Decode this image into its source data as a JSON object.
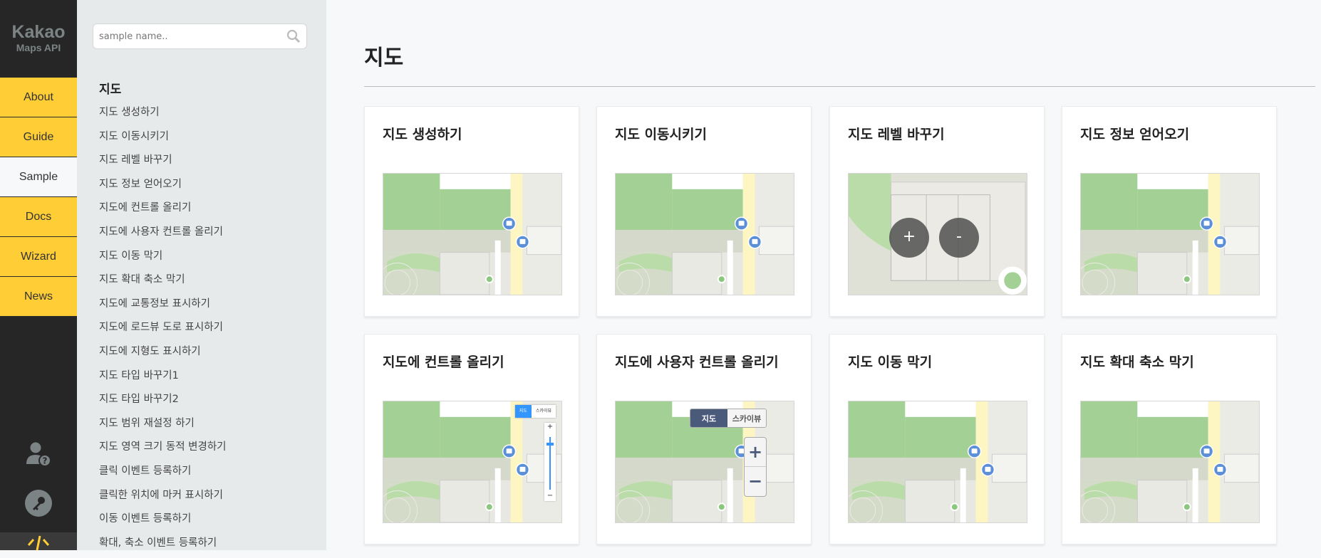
{
  "logo": {
    "line1": "Kakao",
    "line2": "Maps API"
  },
  "nav": [
    {
      "label": "About"
    },
    {
      "label": "Guide"
    },
    {
      "label": "Sample",
      "active": true
    },
    {
      "label": "Docs"
    },
    {
      "label": "Wizard"
    },
    {
      "label": "News"
    }
  ],
  "nav_icons": [
    "user-question-icon",
    "key-icon",
    "code-icon"
  ],
  "search": {
    "placeholder": "sample name..",
    "value": ""
  },
  "sidebar": {
    "heading": "지도",
    "items": [
      "지도 생성하기",
      "지도 이동시키기",
      "지도 레벨 바꾸기",
      "지도 정보 얻어오기",
      "지도에 컨트롤 올리기",
      "지도에 사용자 컨트롤 올리기",
      "지도 이동 막기",
      "지도 확대 축소 막기",
      "지도에 교통정보 표시하기",
      "지도에 로드뷰 도로 표시하기",
      "지도에 지형도 표시하기",
      "지도 타입 바꾸기1",
      "지도 타입 바꾸기2",
      "지도 범위 재설정 하기",
      "지도 영역 크기 동적 변경하기",
      "클릭 이벤트 등록하기",
      "클릭한 위치에 마커 표시하기",
      "이동 이벤트 등록하기",
      "확대, 축소 이벤트 등록하기"
    ]
  },
  "main": {
    "title": "지도",
    "cards": [
      {
        "title": "지도 생성하기"
      },
      {
        "title": "지도 이동시키기"
      },
      {
        "title": "지도 레벨 바꾸기",
        "zoom_in": "+",
        "zoom_out": "-"
      },
      {
        "title": "지도 정보 얻어오기"
      },
      {
        "title": "지도에 컨트롤 올리기",
        "maptype": [
          "지도",
          "스카이뷰"
        ]
      },
      {
        "title": "지도에 사용자 컨트롤 올리기",
        "maptype": [
          "지도",
          "스카이뷰"
        ],
        "zoom_in": "+",
        "zoom_out": "−"
      },
      {
        "title": "지도 이동 막기"
      },
      {
        "title": "지도 확대 축소 막기"
      }
    ]
  },
  "colors": {
    "nav_bg": "#262626",
    "nav_item": "#ffcd35",
    "sidebar_bg": "#e7eaeb",
    "main_bg": "#f7f8fa",
    "map_green": "#a3d195",
    "road": "#fdf6c3",
    "bus": "#5b8fd8"
  }
}
